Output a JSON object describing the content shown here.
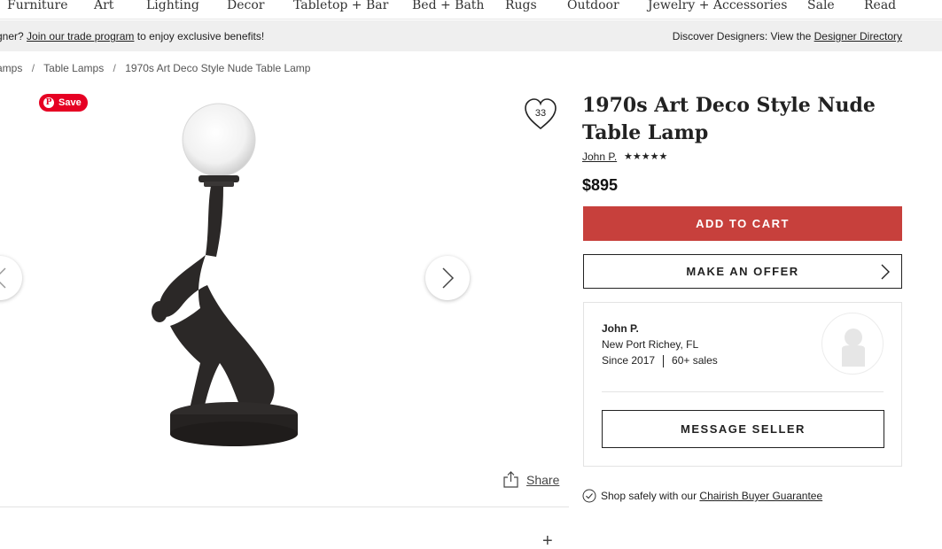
{
  "nav": {
    "items": [
      "Furniture",
      "Art",
      "Lighting",
      "Decor",
      "Tabletop + Bar",
      "Bed + Bath",
      "Rugs",
      "Outdoor",
      "Jewelry + Accessories",
      "Sale",
      "Read"
    ]
  },
  "banner": {
    "left_prefix": "gner? ",
    "trade_link": "Join our trade program",
    "left_suffix": " to enjoy exclusive benefits!",
    "right_prefix": "Discover Designers: View the ",
    "designer_link": "Designer Directory"
  },
  "breadcrumb": {
    "items": [
      "amps",
      "Table Lamps",
      "1970s Art Deco Style Nude Table Lamp"
    ],
    "separator": "/"
  },
  "gallery": {
    "save_label": "Save",
    "favorites_count": "33",
    "share_label": "Share",
    "expand_symbol": "+"
  },
  "product": {
    "title": "1970s Art Deco Style Nude Table Lamp",
    "seller_name": "John P.",
    "rating_stars": "★★★★★",
    "price": "$895",
    "add_to_cart": "ADD TO CART",
    "make_offer": "MAKE AN OFFER"
  },
  "seller_card": {
    "name": "John P.",
    "location": "New Port Richey, FL",
    "since": "Since 2017",
    "sales": "60+ sales",
    "message_button": "MESSAGE SELLER"
  },
  "guarantee": {
    "prefix": "Shop safely with our ",
    "link": "Chairish Buyer Guarantee"
  },
  "colors": {
    "accent_red": "#c7403c",
    "pinterest_red": "#e60023",
    "banner_bg": "#efefef"
  },
  "icons": [
    "pinterest-icon",
    "heart-icon",
    "chevron-left-icon",
    "chevron-right-icon",
    "share-icon",
    "plus-icon",
    "avatar-silhouette-icon",
    "check-circle-icon"
  ]
}
